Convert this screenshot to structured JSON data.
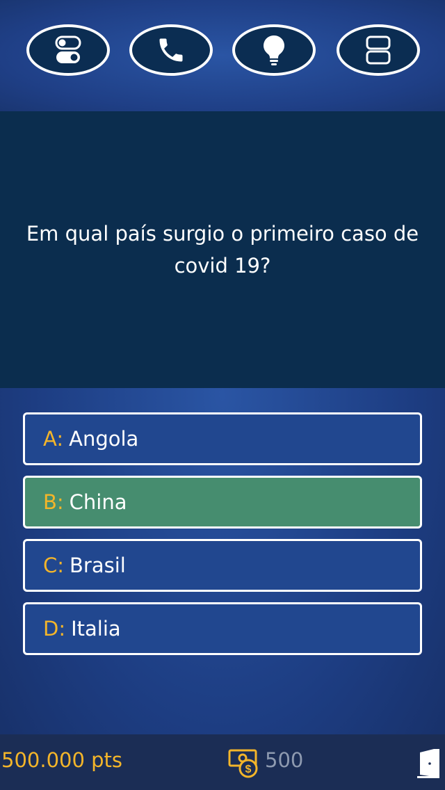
{
  "lifelines": [
    {
      "name": "toggle-icon"
    },
    {
      "name": "phone-icon"
    },
    {
      "name": "lightbulb-icon"
    },
    {
      "name": "layout-rows-icon"
    }
  ],
  "question": {
    "text": "Em qual país surgio o primeiro caso de covid 19?"
  },
  "answers": [
    {
      "letter": "A:",
      "text": "Angola",
      "selected": false
    },
    {
      "letter": "B:",
      "text": "China",
      "selected": true
    },
    {
      "letter": "C:",
      "text": "Brasil",
      "selected": false
    },
    {
      "letter": "D:",
      "text": "Italia",
      "selected": false
    }
  ],
  "footer": {
    "score": "500.000 pts",
    "coins": "500",
    "money_icon": "money-icon",
    "exit_icon": "exit-door-icon"
  },
  "colors": {
    "accent_gold": "#f3b52a",
    "answer_bg": "#21478f",
    "selected_bg": "#468d6f",
    "question_bg": "#0b2d4e"
  }
}
